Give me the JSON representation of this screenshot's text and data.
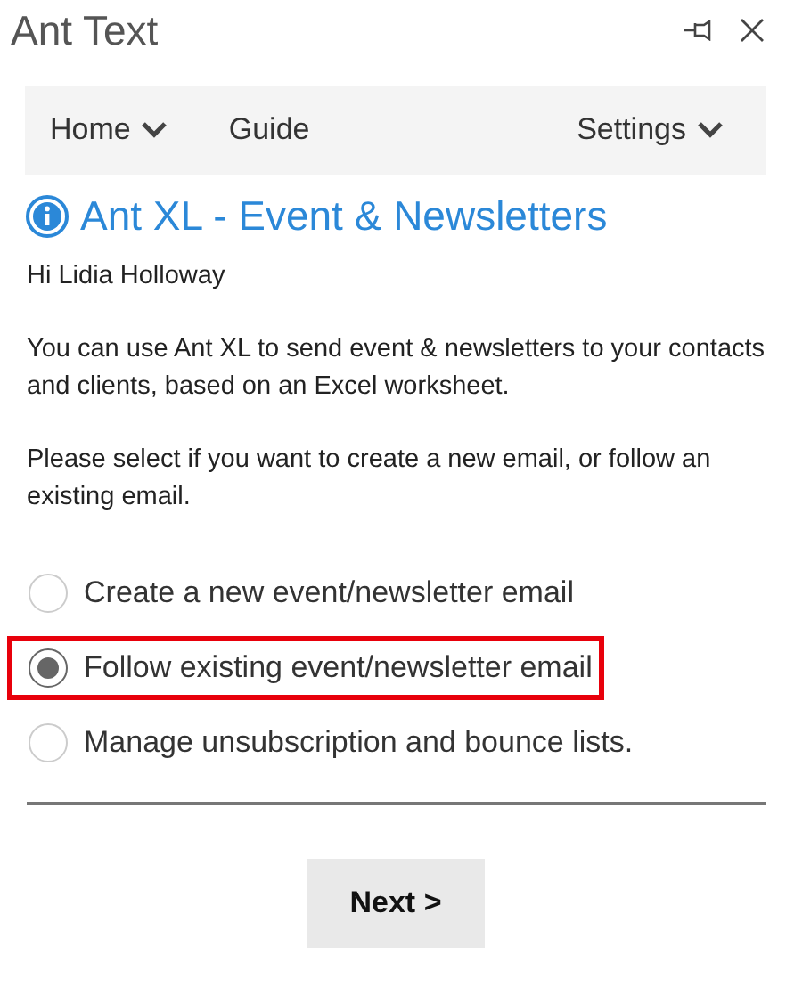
{
  "window": {
    "title": "Ant Text"
  },
  "nav": [
    {
      "label": "Home",
      "dropdown": true
    },
    {
      "label": "Guide",
      "dropdown": false
    },
    {
      "label": "Settings",
      "dropdown": true
    }
  ],
  "heading": "Ant XL - Event & Newsletters",
  "greeting": "Hi Lidia Holloway",
  "intro": "You can use Ant XL to send event & newsletters to your contacts and clients, based on an Excel worksheet.",
  "prompt": "Please select if you want to create a new email, or follow an existing email.",
  "options": [
    {
      "label": "Create a new event/newsletter email",
      "selected": false,
      "highlighted": false
    },
    {
      "label": "Follow existing event/newsletter email",
      "selected": true,
      "highlighted": true
    },
    {
      "label": "Manage unsubscription and bounce lists.",
      "selected": false,
      "highlighted": false
    }
  ],
  "next_button": "Next >"
}
